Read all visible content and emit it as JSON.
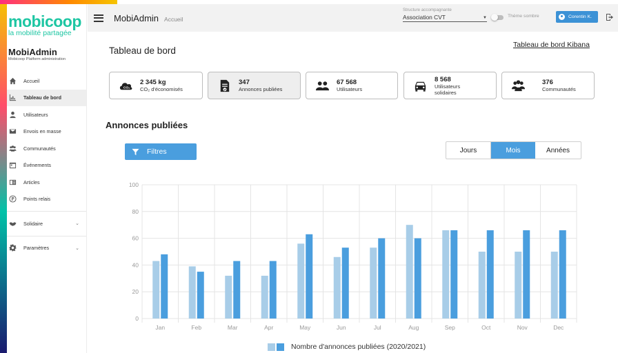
{
  "brand": {
    "logo_word": "mobicoop",
    "tagline": "la mobilité partagée",
    "app_name": "MobiAdmin",
    "app_subtitle": "Mobicoop Platform administration",
    "accent": "#1ec6a3"
  },
  "sidebar": {
    "items": [
      {
        "label": "Accueil",
        "icon": "home-icon",
        "active": false
      },
      {
        "label": "Tableau de bord",
        "icon": "dashboard-icon",
        "active": true
      },
      {
        "label": "Utilisateurs",
        "icon": "user-icon",
        "active": false
      },
      {
        "label": "Envois en masse",
        "icon": "mail-icon",
        "active": false
      },
      {
        "label": "Communautés",
        "icon": "community-icon",
        "active": false
      },
      {
        "label": "Événements",
        "icon": "calendar-icon",
        "active": false
      },
      {
        "label": "Articles",
        "icon": "article-icon",
        "active": false
      },
      {
        "label": "Points relais",
        "icon": "parking-icon",
        "active": false
      }
    ],
    "groups": [
      {
        "label": "Solidaire",
        "icon": "handshake-icon"
      },
      {
        "label": "Paramètres",
        "icon": "gear-icon"
      }
    ]
  },
  "topbar": {
    "title": "MobiAdmin",
    "crumb": "Accueil",
    "structure_label": "Structure accompagnante",
    "structure_value": "Association CVT",
    "theme_label": "Thème sombre",
    "user_label": "Corentin K."
  },
  "main": {
    "page_title": "Tableau de bord",
    "kibana_link": "Tableau de bord Kibana",
    "stats": [
      {
        "value": "2 345 kg",
        "label": "CO₂ d'économisés",
        "icon": "cloud-co2-icon"
      },
      {
        "value": "347",
        "label": "Annonces publiées",
        "icon": "document-check-icon",
        "selected": true
      },
      {
        "value": "67 568",
        "label": "Utilisateurs",
        "icon": "users-icon"
      },
      {
        "value": "8 568",
        "label": "Utilisateurs",
        "label2": "solidaires",
        "icon": "car-icon"
      },
      {
        "value": "376",
        "label": "Communautés",
        "icon": "community-group-icon"
      }
    ],
    "section_title": "Annonces publiées",
    "filters_label": "Filtres",
    "period": {
      "options": [
        "Jours",
        "Mois",
        "Années"
      ],
      "selected": "Mois"
    }
  },
  "chart_data": {
    "type": "bar",
    "categories": [
      "Jan",
      "Feb",
      "Mar",
      "Apr",
      "May",
      "Jun",
      "Jul",
      "Aug",
      "Sep",
      "Oct",
      "Nov",
      "Dec"
    ],
    "series": [
      {
        "name": "2020",
        "values": [
          43,
          39,
          32,
          32,
          56,
          46,
          53,
          70,
          66,
          50,
          50,
          50
        ],
        "color": "#a8cde8"
      },
      {
        "name": "2021",
        "values": [
          48,
          35,
          43,
          43,
          63,
          53,
          60,
          60,
          66,
          66,
          66,
          66
        ],
        "color": "#4a9ede"
      }
    ],
    "yticks": [
      0,
      20,
      40,
      60,
      80,
      100
    ],
    "ylim": [
      0,
      100
    ],
    "grid": true,
    "legend": "Nombre d'annonces publiées (2020/2021)",
    "legend_position": "bottom-center"
  }
}
